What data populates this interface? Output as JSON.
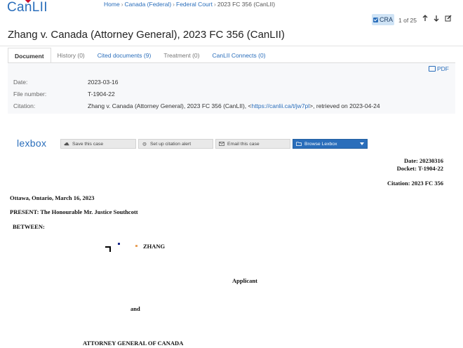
{
  "site": {
    "logo": "CanLII"
  },
  "breadcrumb": [
    "Home",
    "Canada (Federal)",
    "Federal Court",
    "2023 FC 356 (CanLII)"
  ],
  "toolbar": {
    "cra_label": "CRA",
    "result_count": "1 of 25"
  },
  "case_title": "Zhang v. Canada (Attorney General), 2023 FC 356 (CanLII)",
  "tabs": [
    {
      "label": "Document"
    },
    {
      "label": "History (0)"
    },
    {
      "label": "Cited documents (9)"
    },
    {
      "label": "Treatment (0)"
    },
    {
      "label": "CanLII Connects (0)"
    }
  ],
  "pdf_label": "PDF",
  "meta": {
    "date_label": "Date:",
    "date_value": "2023-03-16",
    "file_label": "File number:",
    "file_value": "T-1904-22",
    "citation_label": "Citation:",
    "citation_prefix": "Zhang v. Canada (Attorney General), 2023 FC 356 (CanLII), <",
    "citation_url": "https://canlii.ca/t/jw7pl",
    "citation_suffix": ">, retrieved on 2023-04-24"
  },
  "lexbox": {
    "logo": "lexbox",
    "save": "Save this case",
    "alert": "Set up citation alert",
    "email": "Email this case",
    "browse": "Browse Lexbox"
  },
  "document": {
    "date_line": "Date: 20230316",
    "docket_line": "Docket: T-1904-22",
    "citation_line": "Citation: 2023 FC 356",
    "place_date": "Ottawa, Ontario, March 16, 2023",
    "present": "PRESENT: The Honourable Mr. Justice Southcott",
    "between": "BETWEEN:",
    "applicant_name": "ZHANG",
    "applicant_role": "Applicant",
    "and": "and",
    "respondent_name": "ATTORNEY GENERAL OF CANADA"
  },
  "colors": {
    "accent": "#2a6ebb",
    "cra_bg": "#cfe3f5",
    "browse_bg": "#2a6ebb"
  }
}
